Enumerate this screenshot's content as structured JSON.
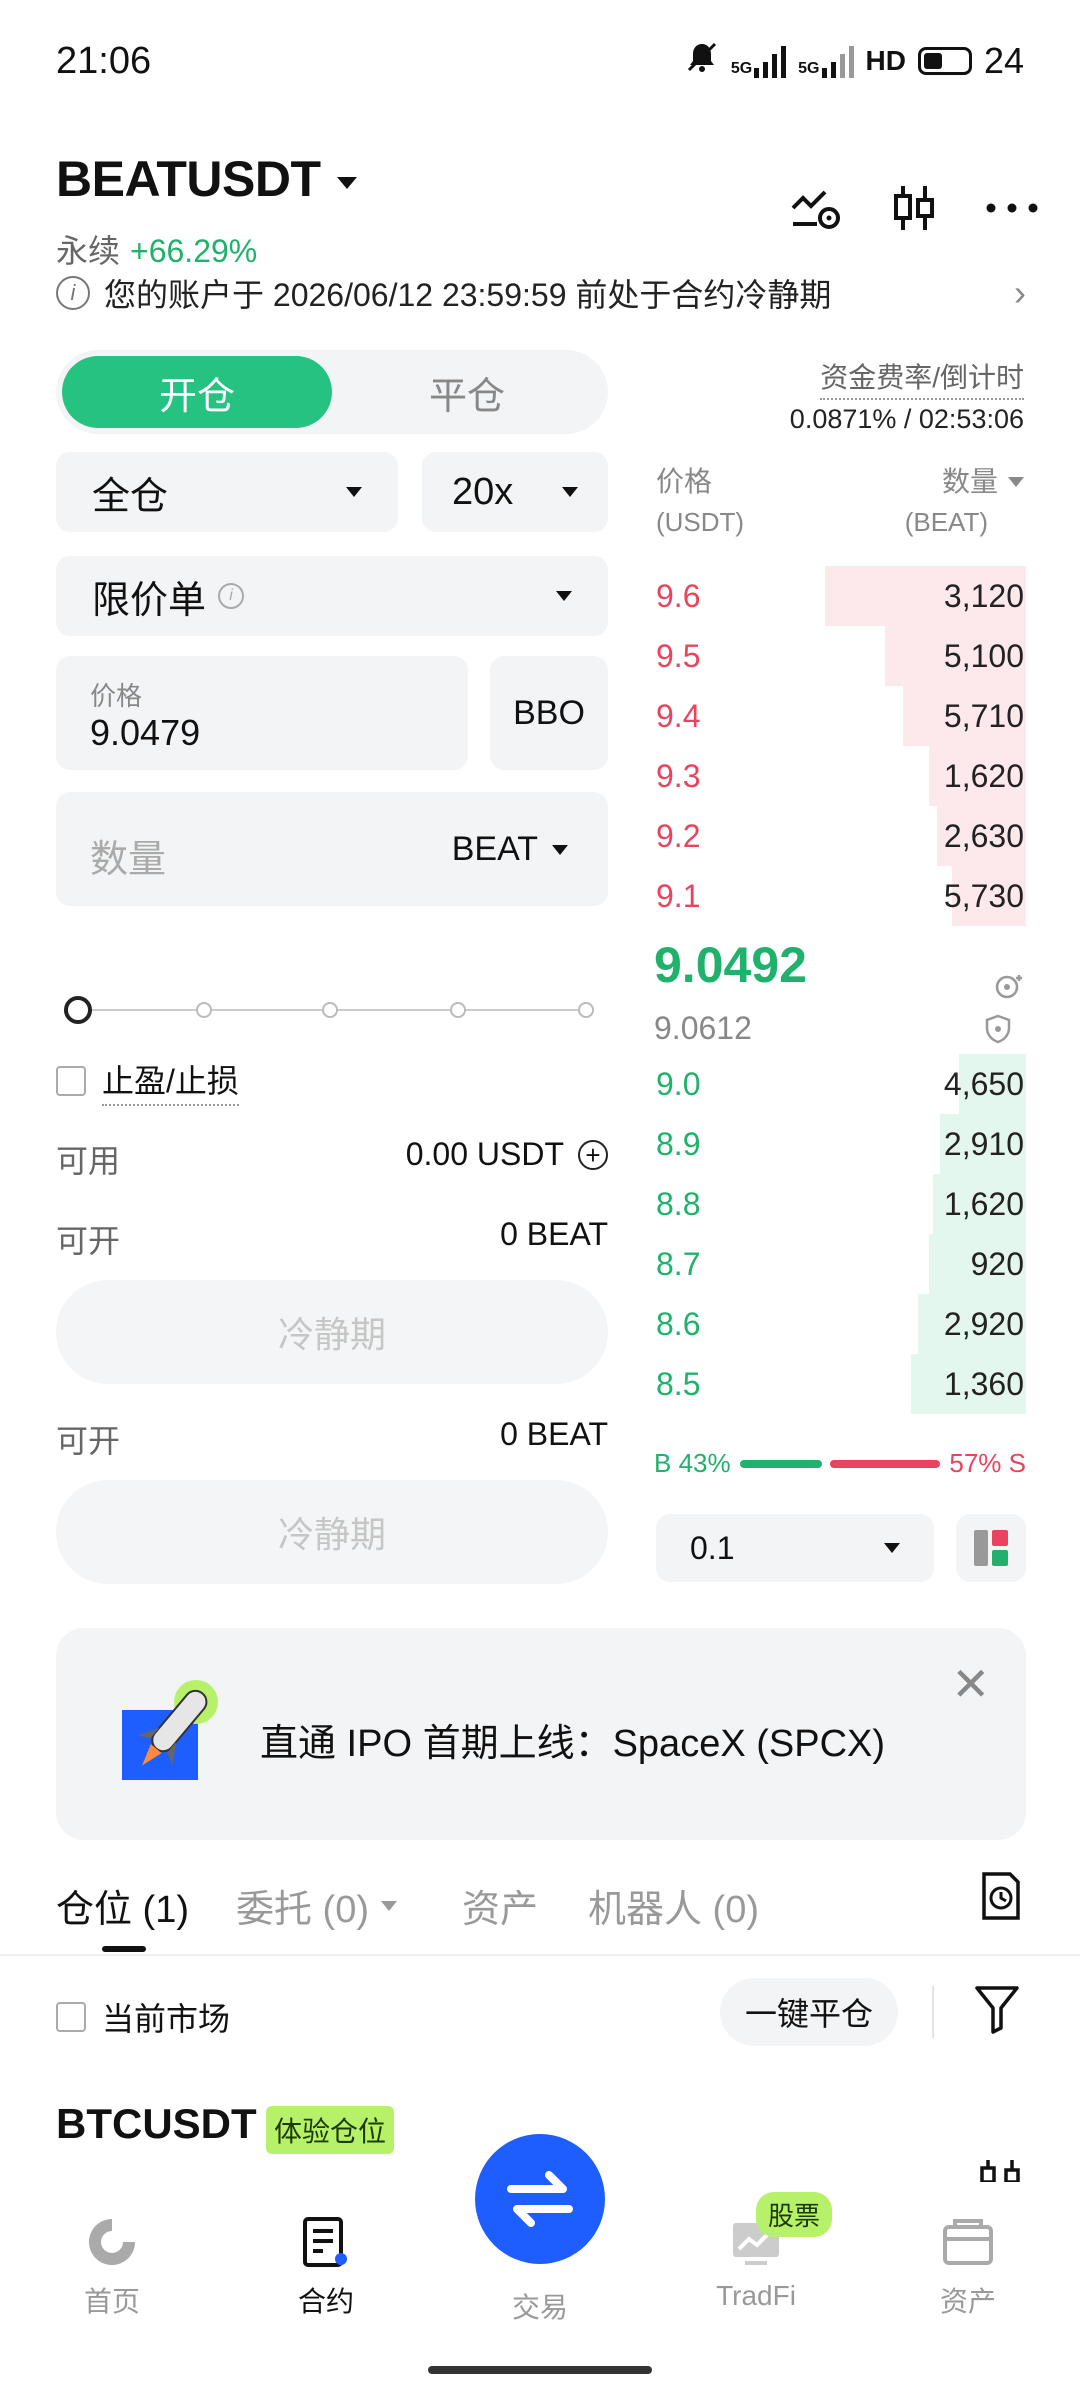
{
  "status": {
    "time": "21:06",
    "net1": "5G",
    "net2": "5G",
    "hd": "HD",
    "battery": "24"
  },
  "header": {
    "pair": "BEATUSDT",
    "type": "永续",
    "change": "+66.29%",
    "notice": "您的账户于 2026/06/12 23:59:59 前处于合约冷静期"
  },
  "order": {
    "tab_open": "开仓",
    "tab_close": "平仓",
    "margin_mode": "全仓",
    "leverage": "20x",
    "order_type": "限价单",
    "price_label": "价格",
    "price_value": "9.0479",
    "bbo": "BBO",
    "qty_placeholder": "数量",
    "qty_unit": "BEAT",
    "slider_steps": 5,
    "slider_value": 0,
    "tpsl_label": "止盈/止损",
    "avail_label": "可用",
    "avail_value": "0.00 USDT",
    "can_open_label": "可开",
    "can_open_value": "0 BEAT",
    "cooldown_btn": "冷静期",
    "can_open_label2": "可开",
    "can_open_value2": "0 BEAT",
    "cooldown_btn2": "冷静期"
  },
  "orderbook": {
    "funding_label": "资金费率/倒计时",
    "funding_value": "0.0871% / 02:53:06",
    "col_price": "价格",
    "col_price_unit": "(USDT)",
    "col_qty": "数量",
    "col_qty_unit": "(BEAT)",
    "asks": [
      {
        "price": "9.6",
        "qty": "3,120",
        "depth": 0.54
      },
      {
        "price": "9.5",
        "qty": "5,100",
        "depth": 0.38
      },
      {
        "price": "9.4",
        "qty": "5,710",
        "depth": 0.33
      },
      {
        "price": "9.3",
        "qty": "1,620",
        "depth": 0.26
      },
      {
        "price": "9.2",
        "qty": "2,630",
        "depth": 0.24
      },
      {
        "price": "9.1",
        "qty": "5,730",
        "depth": 0.2
      }
    ],
    "last_price": "9.0492",
    "mark_price": "9.0612",
    "bids": [
      {
        "price": "9.0",
        "qty": "4,650",
        "depth": 0.18
      },
      {
        "price": "8.9",
        "qty": "2,910",
        "depth": 0.23
      },
      {
        "price": "8.8",
        "qty": "1,620",
        "depth": 0.25
      },
      {
        "price": "8.7",
        "qty": "920",
        "depth": 0.26
      },
      {
        "price": "8.6",
        "qty": "2,920",
        "depth": 0.29
      },
      {
        "price": "8.5",
        "qty": "1,360",
        "depth": 0.31
      }
    ],
    "buy_ratio": "B 43%",
    "sell_ratio": "57% S",
    "buy_pct": 43,
    "sell_pct": 57,
    "precision": "0.1"
  },
  "banner": {
    "text": "直通 IPO 首期上线：SpaceX (SPCX)"
  },
  "positions": {
    "tabs": [
      "仓位 (1)",
      "委托 (0)",
      "资产",
      "机器人 (0)"
    ],
    "current_market": "当前市场",
    "one_click": "一键平仓",
    "symbol": "BTCUSDT",
    "badge": "体验仓位"
  },
  "nav": {
    "items": [
      "首页",
      "合约",
      "交易",
      "TradFi",
      "资产"
    ],
    "stock_badge": "股票"
  },
  "colors": {
    "green": "#20b26c",
    "red": "#e9445f",
    "accent": "#1e5eff"
  }
}
